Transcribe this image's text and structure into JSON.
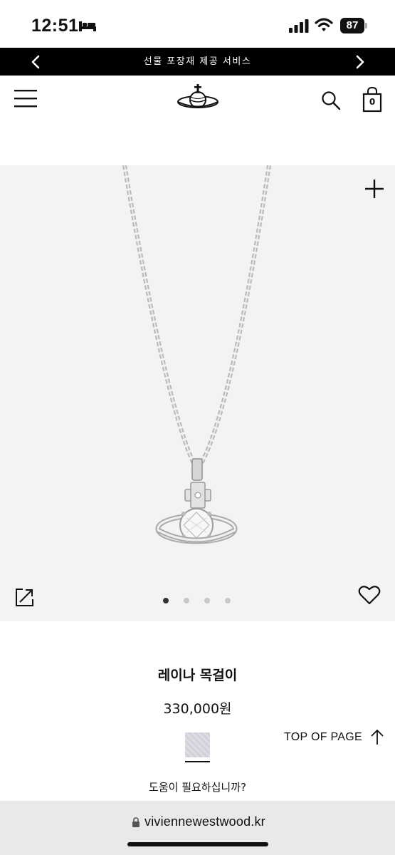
{
  "status_bar": {
    "time": "12:51",
    "battery": "87"
  },
  "promo_banner": {
    "text": "선물 포장재 제공 서비스"
  },
  "header": {
    "bag_count": "0"
  },
  "gallery": {
    "total_images": 4,
    "active_index": 0
  },
  "product": {
    "name": "레이나 목걸이",
    "price": "330,000원"
  },
  "top_of_page": {
    "label": "TOP OF PAGE"
  },
  "help": {
    "text": "도움이 필요하십니까?"
  },
  "browser": {
    "url": "viviennewestwood.kr"
  },
  "colors": {
    "banner_bg": "#000000",
    "gallery_bg": "#f3f3f2"
  }
}
